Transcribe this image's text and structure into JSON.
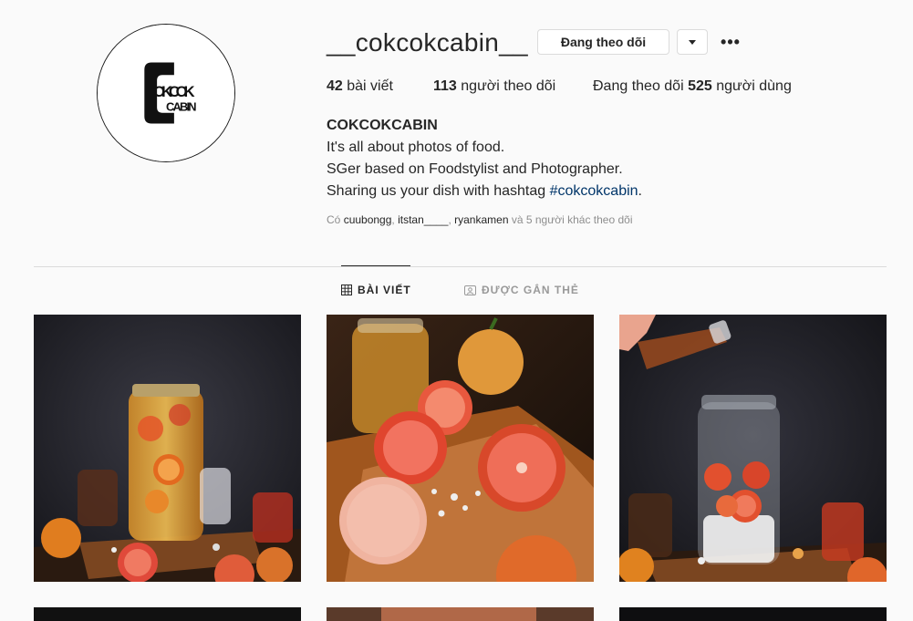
{
  "profile": {
    "username": "__cokcokcabin__",
    "follow_button_label": "Đang theo dõi",
    "more_label": "•••",
    "avatar_logo_text": [
      "OKCOK",
      "CABIN"
    ]
  },
  "stats": {
    "posts_count": "42",
    "posts_label": "bài viết",
    "followers_count": "113",
    "followers_label": "người theo dõi",
    "following_prefix": "Đang theo dõi",
    "following_count": "525",
    "following_label": "người dùng"
  },
  "bio": {
    "name": "COKCOKCABIN",
    "line1": "It's all about photos of food.",
    "line2": "SGer based on Foodstylist and Photographer.",
    "line3_prefix": "Sharing us your dish with hashtag ",
    "line3_hashtag": "#cokcokcabin",
    "line3_suffix": "."
  },
  "followed_by": {
    "prefix": "Có ",
    "users": [
      "cuubongg",
      "itstan____",
      "ryankamen"
    ],
    "sep1": ", ",
    "sep2": ", ",
    "suffix": " và 5 người khác theo dõi"
  },
  "tabs": [
    {
      "label": "BÀI VIẾT",
      "icon": "grid-icon",
      "active": true
    },
    {
      "label": "ĐƯỢC GẮN THẺ",
      "icon": "tag-icon",
      "active": false
    }
  ],
  "posts": [
    {
      "id": 1,
      "subject": "jar-of-citrus-drink"
    },
    {
      "id": 2,
      "subject": "blood-oranges-on-board"
    },
    {
      "id": 3,
      "subject": "pouring-syrup-into-jar"
    },
    {
      "id": 4
    },
    {
      "id": 5
    },
    {
      "id": 6
    }
  ],
  "colors": {
    "background": "#fafafa",
    "text": "#262626",
    "muted": "#8e8e8e",
    "border": "#dbdbdb",
    "hashtag": "#003569"
  }
}
